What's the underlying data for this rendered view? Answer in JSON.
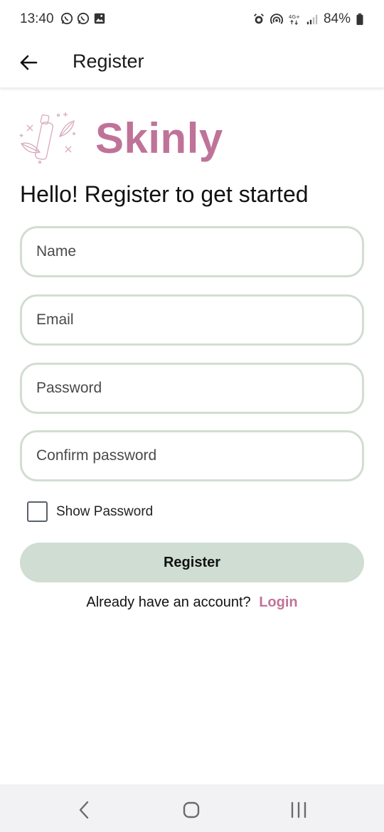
{
  "status_bar": {
    "time": "13:40",
    "battery": "84%",
    "left_icons": [
      "whatsapp-icon",
      "whatsapp-icon",
      "gallery-icon"
    ],
    "right_icons": [
      "alarm-icon",
      "hotspot-icon",
      "4g-icon",
      "signal-icon",
      "battery-icon"
    ]
  },
  "app_bar": {
    "title": "Register",
    "back_icon": "arrow-left-icon"
  },
  "brand": {
    "name": "Skinly",
    "color": "#c07399"
  },
  "form": {
    "heading": "Hello! Register to get started",
    "fields": [
      {
        "placeholder": "Name"
      },
      {
        "placeholder": "Email"
      },
      {
        "placeholder": "Password"
      },
      {
        "placeholder": "Confirm password"
      }
    ],
    "show_password_label": "Show Password",
    "show_password_checked": false,
    "submit_label": "Register",
    "login_prompt": "Already have an account?",
    "login_link": "Login"
  },
  "colors": {
    "accent": "#c07399",
    "field_border": "#d2ddd2",
    "button_bg": "#d0ddd2"
  },
  "nav_bar": {
    "icons": [
      "back-nav-icon",
      "home-nav-icon",
      "recents-nav-icon"
    ]
  }
}
